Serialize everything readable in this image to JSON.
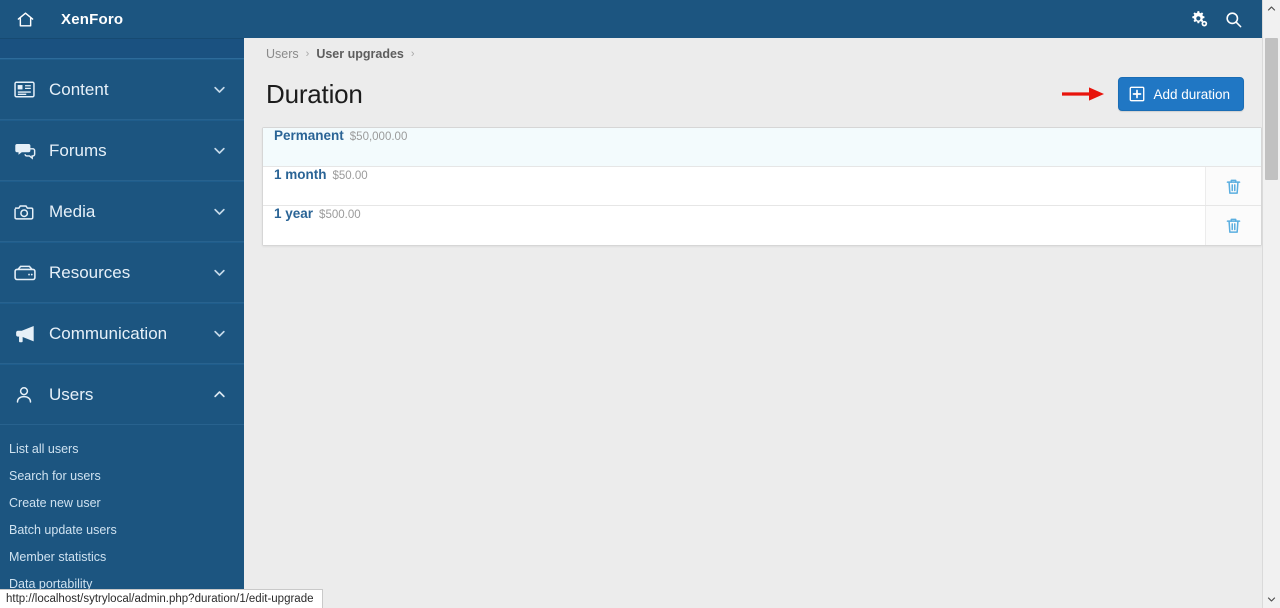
{
  "topbar": {
    "brand": "XenForo",
    "home_icon": "home-icon",
    "settings_icon": "cogs-icon",
    "search_icon": "search-icon"
  },
  "sidebar": {
    "items": [
      {
        "label": "Content",
        "icon": "content-icon",
        "chevron": "chevron-down",
        "expanded": false
      },
      {
        "label": "Forums",
        "icon": "forums-icon",
        "chevron": "chevron-down",
        "expanded": false
      },
      {
        "label": "Media",
        "icon": "camera-icon",
        "chevron": "chevron-down",
        "expanded": false
      },
      {
        "label": "Resources",
        "icon": "resources-icon",
        "chevron": "chevron-down",
        "expanded": false
      },
      {
        "label": "Communication",
        "icon": "megaphone-icon",
        "chevron": "chevron-down",
        "expanded": false
      },
      {
        "label": "Users",
        "icon": "user-icon",
        "chevron": "chevron-up",
        "expanded": true
      }
    ],
    "users_subitems": [
      {
        "label": "List all users"
      },
      {
        "label": "Search for users"
      },
      {
        "label": "Create new user"
      },
      {
        "label": "Batch update users"
      },
      {
        "label": "Member statistics"
      },
      {
        "label": "Data portability"
      }
    ]
  },
  "main": {
    "breadcrumb": [
      {
        "label": "Users",
        "strong": false
      },
      {
        "label": "User upgrades",
        "strong": true
      }
    ],
    "breadcrumb_separator": "›",
    "title": "Duration",
    "add_button": {
      "label": "Add duration",
      "icon": "plus-square-icon"
    },
    "pointer_annotation": "red-arrow",
    "rows": [
      {
        "title": "Permanent",
        "price": "$50,000.00",
        "highlighted": true,
        "delete_icon": "trash-icon",
        "delete_visible": false
      },
      {
        "title": "1 month",
        "price": "$50.00",
        "highlighted": false,
        "delete_icon": "trash-icon",
        "delete_visible": true
      },
      {
        "title": "1 year",
        "price": "$500.00",
        "highlighted": false,
        "delete_icon": "trash-icon",
        "delete_visible": true
      }
    ]
  },
  "status_bar": {
    "url": "http://localhost/sytrylocal/admin.php?duration/1/edit-upgrade"
  },
  "colors": {
    "sidebar_blue": "#1c5580",
    "button_blue": "#2077c4",
    "link_blue": "#2a6496",
    "row_highlight": "#f3fbfd",
    "page_bg": "#ececec",
    "arrow_red": "#e8140c",
    "trash_blue": "#5aaee0"
  }
}
